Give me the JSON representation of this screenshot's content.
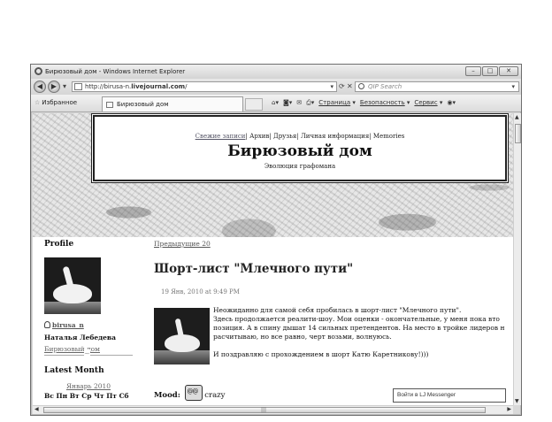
{
  "browser": {
    "window_title": "Бирюзовый дом - Windows Internet Explorer",
    "window_buttons": [
      "–",
      "□",
      "✕"
    ],
    "address_prefix": "http://birusa-n.",
    "address_domain": "livejournal.com",
    "address_suffix": "/",
    "search_placeholder": "QIP Search",
    "favorites_label": "Избранное",
    "tab_title": "Бирюзовый дом",
    "tools": {
      "page": "Страница",
      "safety": "Безопасность",
      "service": "Сервис"
    }
  },
  "header": {
    "nav_fresh": "Свежие записи",
    "nav_archive": "Архив",
    "nav_friends": "Друзья",
    "nav_info": "Личная информация",
    "nav_memories": "Memories",
    "title": "Бирюзовый дом",
    "subtitle": "Эволюция графомана"
  },
  "sidebar": {
    "profile_heading": "Profile",
    "username": "birusa_n",
    "full_name": "Наталья Лебедева",
    "journal_name": "Бирюзовый дом",
    "latest_heading": "Latest Month",
    "month": "Январь 2010",
    "weekdays": "Вс Пн Вт Ср Чт Пт Сб"
  },
  "post": {
    "prev_link": "Предыдущие 20",
    "title": "Шорт-лист \"Млечного пути\"",
    "date": "19 Янв, 2010 at 9:49 PM",
    "lines": [
      "Неожиданно для самой себя пробилась в шорт-лист \"Млечного пути\".",
      "Здесь продолжается реалити-шоу. Мои оценки - окончательные, у меня пока вто",
      "позиция. А в спину дышат 14 сильных претендентов. На место в тройке лидеров н",
      "расчитываю, но все равно, черт возьми, волнуюсь."
    ],
    "closing": "И поздравляю с прохождением в шорт Катю Каретникову!)))",
    "mood_label": "Mood:",
    "mood_value": "crazy"
  },
  "messenger": {
    "label": "Войти в LJ Messenger"
  }
}
